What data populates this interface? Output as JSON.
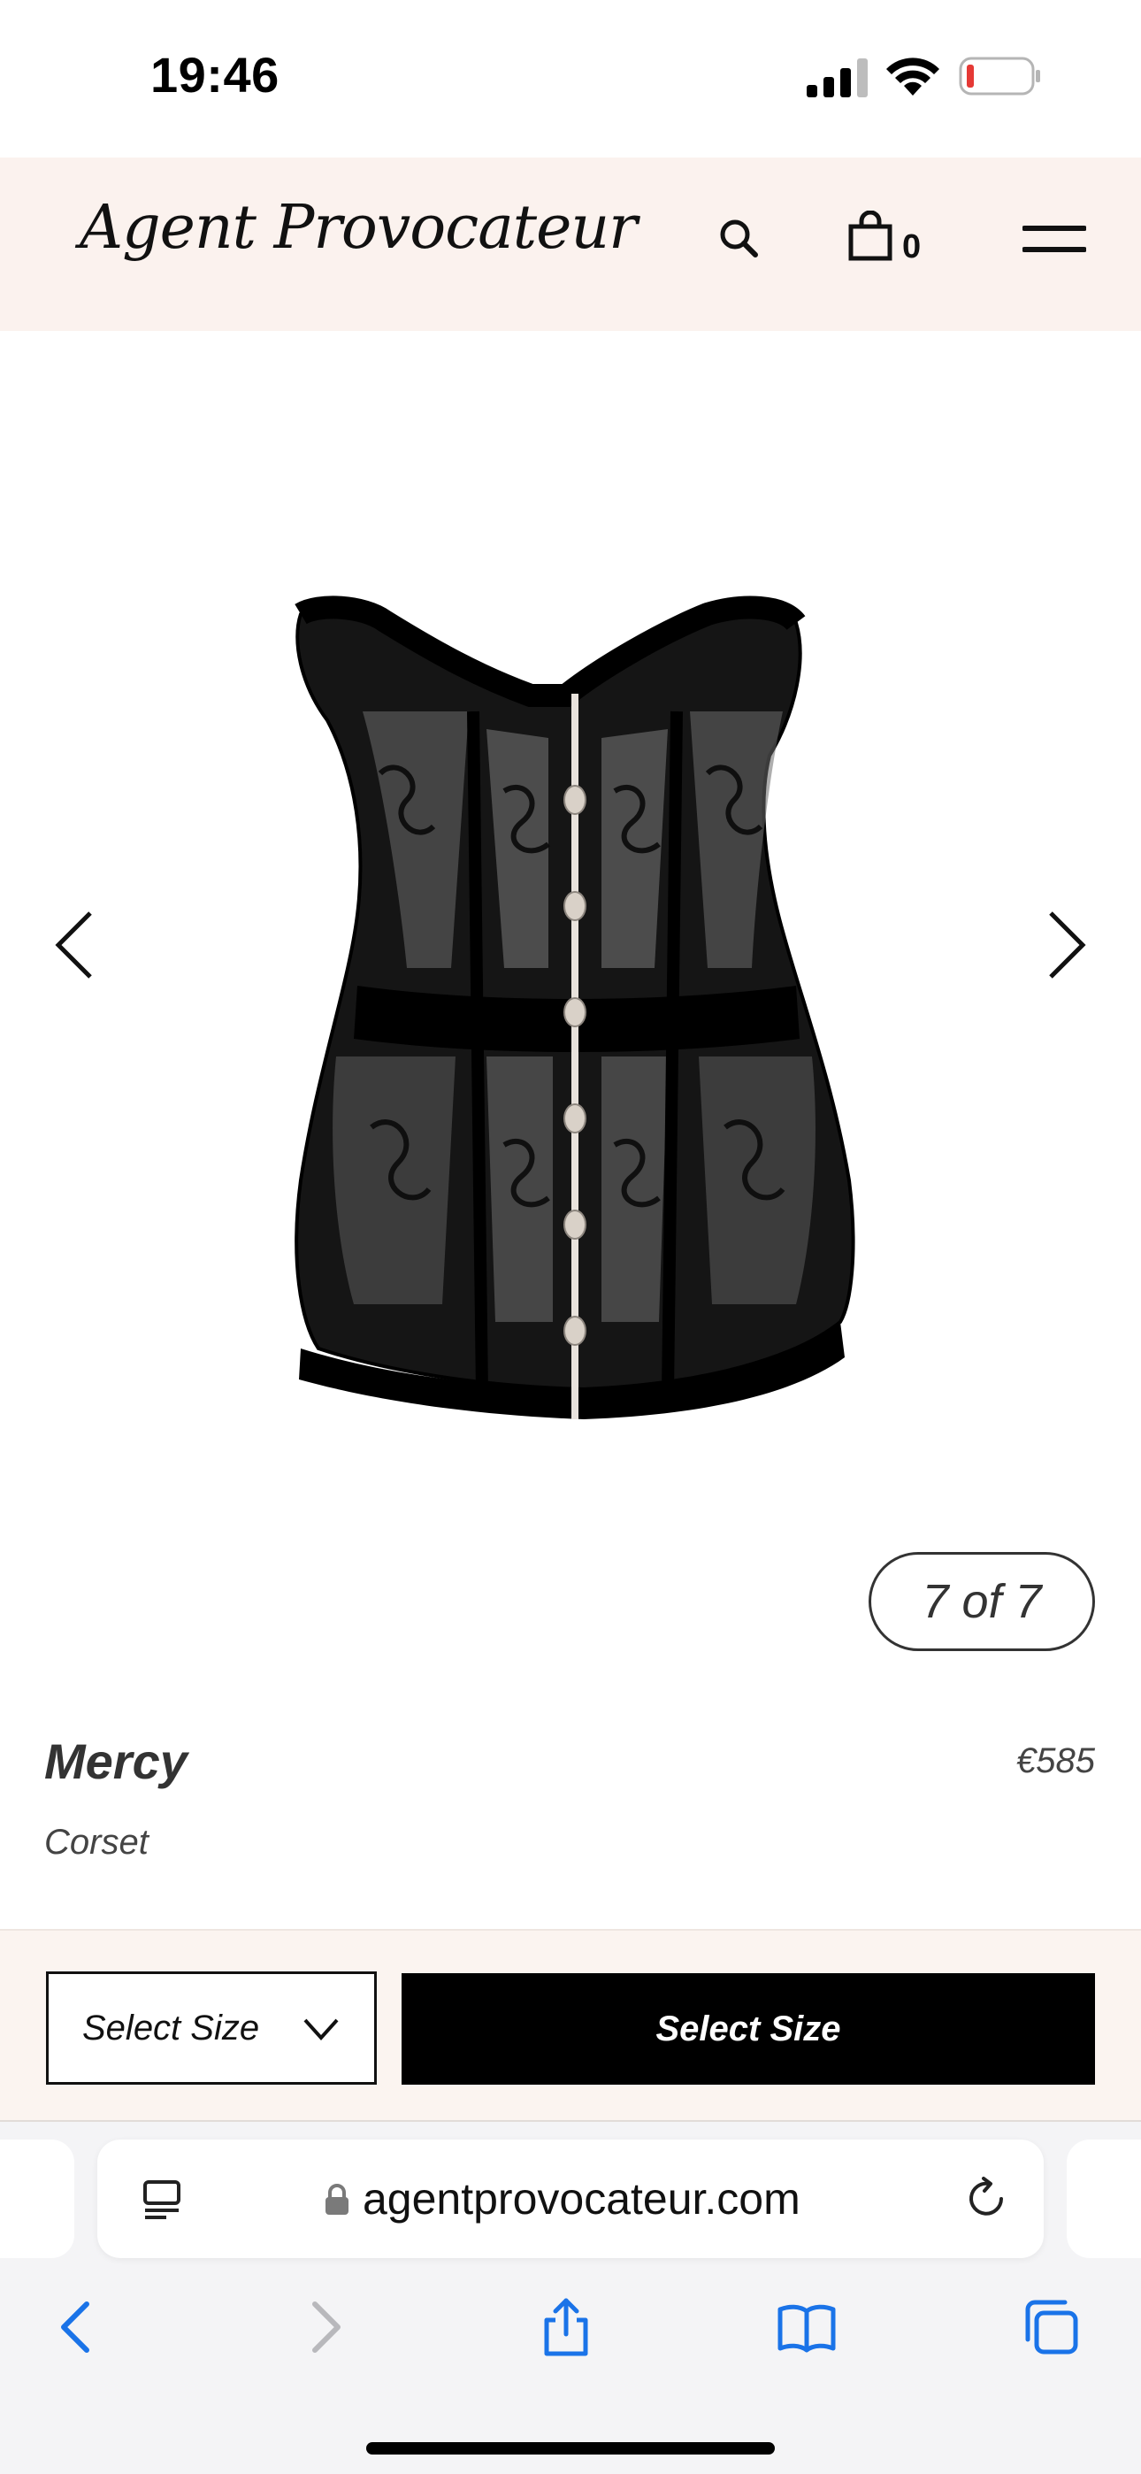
{
  "status_bar": {
    "time": "19:46"
  },
  "header": {
    "brand": "Agent Provocateur",
    "bag_count": "0",
    "icons": [
      "search-icon",
      "bag-icon",
      "menu-icon"
    ]
  },
  "gallery": {
    "counter": "7 of 7",
    "image_subject": "black lace corset"
  },
  "product": {
    "name": "Mercy",
    "type": "Corset",
    "price": "€585"
  },
  "purchase": {
    "size_select_label": "Select Size",
    "button_label": "Select Size"
  },
  "browser": {
    "url": "agentprovocateur.com",
    "toolbar": [
      "back-icon",
      "forward-icon",
      "share-icon",
      "bookmarks-icon",
      "tabs-icon"
    ],
    "accent_color": "#1a73e8"
  },
  "colors": {
    "header_bg": "#fbf2ee",
    "button_bg": "#000000"
  }
}
